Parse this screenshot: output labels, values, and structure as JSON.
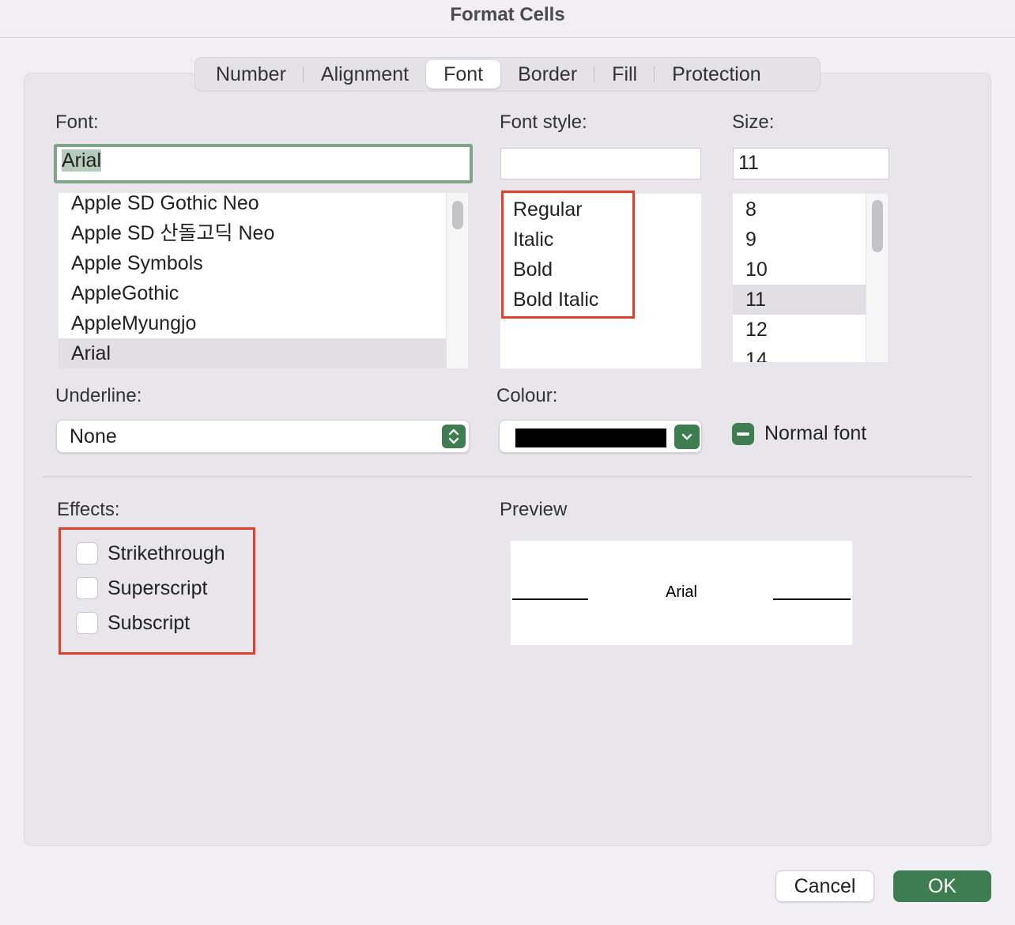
{
  "window": {
    "title": "Format Cells"
  },
  "tabs": [
    {
      "label": "Number"
    },
    {
      "label": "Alignment"
    },
    {
      "label": "Font"
    },
    {
      "label": "Border"
    },
    {
      "label": "Fill"
    },
    {
      "label": "Protection"
    }
  ],
  "font": {
    "label": "Font:",
    "value": "Arial",
    "items": [
      "Apple SD Gothic Neo",
      "Apple SD 산돌고딕 Neo",
      "Apple Symbols",
      "AppleGothic",
      "AppleMyungjo",
      "Arial"
    ],
    "selected": "Arial"
  },
  "font_style": {
    "label": "Font style:",
    "value": "",
    "items": [
      "Regular",
      "Italic",
      "Bold",
      "Bold Italic"
    ]
  },
  "size": {
    "label": "Size:",
    "value": "11",
    "items": [
      "8",
      "9",
      "10",
      "11",
      "12",
      "14"
    ],
    "selected": "11"
  },
  "underline": {
    "label": "Underline:",
    "value": "None"
  },
  "colour": {
    "label": "Colour:",
    "swatch": "#000000"
  },
  "normal_font": {
    "label": "Normal font"
  },
  "effects": {
    "label": "Effects:",
    "items": [
      {
        "label": "Strikethrough",
        "checked": false
      },
      {
        "label": "Superscript",
        "checked": false
      },
      {
        "label": "Subscript",
        "checked": false
      }
    ]
  },
  "preview": {
    "label": "Preview",
    "text": "Arial"
  },
  "buttons": {
    "cancel": "Cancel",
    "ok": "OK"
  },
  "colors": {
    "accent": "#3d7d4f",
    "highlight": "#e0412d",
    "focus_ring": "#7fa487"
  }
}
